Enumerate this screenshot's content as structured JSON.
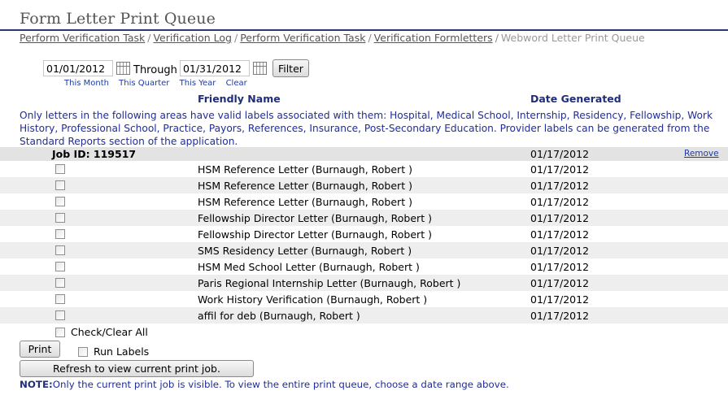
{
  "page": {
    "title": "Form Letter Print Queue"
  },
  "breadcrumb": {
    "items": [
      "Perform Verification Task",
      "Verification Log",
      "Perform Verification Task",
      "Verification Formletters"
    ],
    "current": "Webword Letter Print Queue",
    "separator": "/"
  },
  "filter": {
    "start_date": "01/01/2012",
    "through_label": "Through",
    "end_date": "01/31/2012",
    "filter_label": "Filter",
    "quick_links": [
      "This Month",
      "This Quarter",
      "This Year",
      "Clear"
    ]
  },
  "columns": {
    "friendly_name": "Friendly Name",
    "date_generated": "Date Generated"
  },
  "areas_note": "Only letters in the following areas have valid labels associated with them: Hospital, Medical School, Internship, Residency, Fellowship, Work History, Professional School, Practice, Payors, References, Insurance, Post-Secondary Education. Provider labels can be generated from the Standard Reports section of the application.",
  "job": {
    "label": "Job ID: 119517",
    "date": "01/17/2012",
    "remove_label": "Remove"
  },
  "letters": [
    {
      "name": "HSM Reference Letter (Burnaugh, Robert )",
      "date": "01/17/2012"
    },
    {
      "name": "HSM Reference Letter (Burnaugh, Robert )",
      "date": "01/17/2012"
    },
    {
      "name": "HSM Reference Letter (Burnaugh, Robert )",
      "date": "01/17/2012"
    },
    {
      "name": "Fellowship Director Letter (Burnaugh, Robert )",
      "date": "01/17/2012"
    },
    {
      "name": "Fellowship Director Letter (Burnaugh, Robert )",
      "date": "01/17/2012"
    },
    {
      "name": "SMS Residency Letter (Burnaugh, Robert )",
      "date": "01/17/2012"
    },
    {
      "name": "HSM Med School Letter (Burnaugh, Robert )",
      "date": "01/17/2012"
    },
    {
      "name": "Paris Regional Internship Letter (Burnaugh, Robert )",
      "date": "01/17/2012"
    },
    {
      "name": "Work History Verification (Burnaugh, Robert )",
      "date": "01/17/2012"
    },
    {
      "name": "affil for deb (Burnaugh, Robert )",
      "date": "01/17/2012"
    }
  ],
  "actions": {
    "check_clear_all": "Check/Clear All",
    "print_label": "Print",
    "run_labels": "Run Labels",
    "refresh_label": "Refresh to view current print job."
  },
  "footer": {
    "note_label": "NOTE:",
    "note_text": "Only the current print job is visible. To view the entire print queue, choose a date range above."
  },
  "colors": {
    "title_rule": "#2b3a6b",
    "link_blue": "#1f3a9e",
    "note_blue": "#1f2d9e",
    "row_alt": "#eeeeee",
    "job_row": "#e3e3e3"
  },
  "icons": {
    "calendar": "calendar-icon"
  }
}
